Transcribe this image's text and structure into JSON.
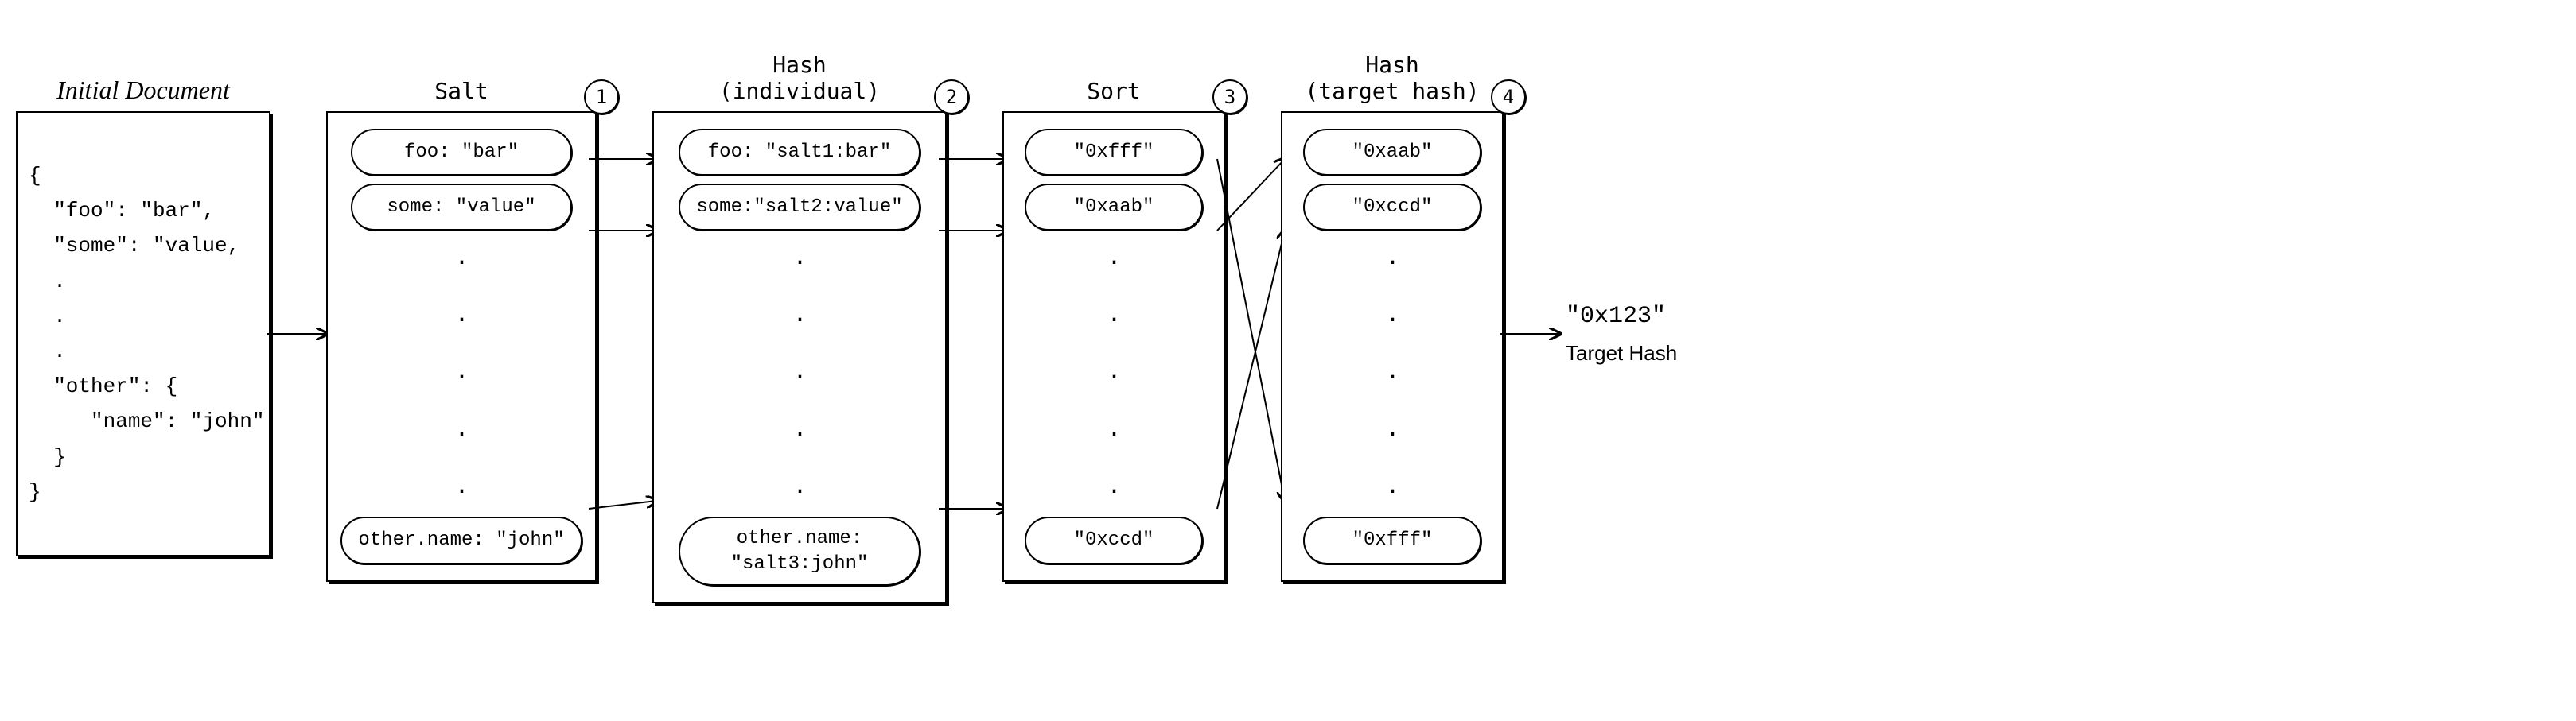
{
  "titles": {
    "initial": "Initial Document",
    "salt": "Salt",
    "hash_individual_l1": "Hash",
    "hash_individual_l2": "(individual)",
    "sort": "Sort",
    "hash_target_l1": "Hash",
    "hash_target_l2": "(target hash)"
  },
  "steps": {
    "s1": "1",
    "s2": "2",
    "s3": "3",
    "s4": "4"
  },
  "document": "{\n  \"foo\": \"bar\",\n  \"some\": \"value,\n  .\n  .\n  .\n  \"other\": {\n     \"name\": \"john\"\n  }\n}",
  "salt_items": {
    "a": "foo: \"bar\"",
    "b": "some: \"value\"",
    "c": "other.name: \"john\""
  },
  "hash_ind_items": {
    "a": "foo: \"salt1:bar\"",
    "b": "some:\"salt2:value\"",
    "c": "other.name:\n\"salt3:john\""
  },
  "sort_items": {
    "a": "\"0xfff\"",
    "b": "\"0xaab\"",
    "c": "\"0xccd\""
  },
  "sorted_items": {
    "a": "\"0xaab\"",
    "b": "\"0xccd\"",
    "c": "\"0xfff\""
  },
  "output": {
    "value": "\"0x123\"",
    "label": "Target Hash"
  },
  "dots": ". . . . ."
}
